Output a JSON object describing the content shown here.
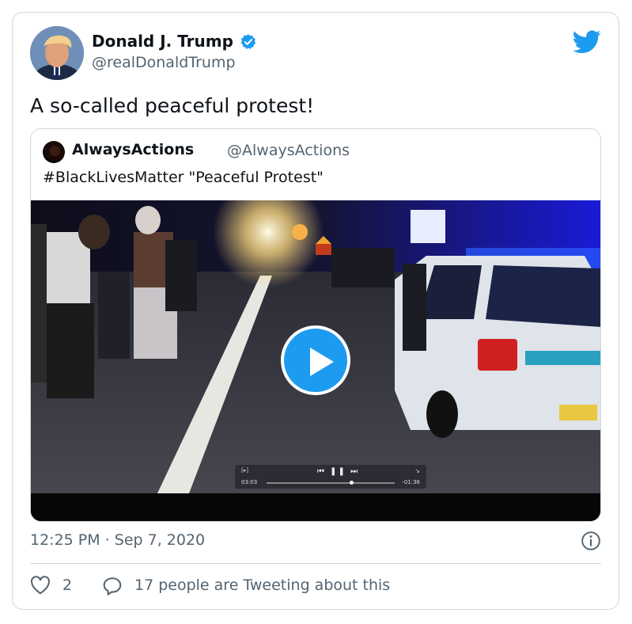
{
  "tweet": {
    "author_name": "Donald J. Trump",
    "author_handle": "@realDonaldTrump",
    "verified": true,
    "text": "A so-called peaceful protest!",
    "timestamp": "12:25 PM · Sep 7, 2020"
  },
  "quoted_tweet": {
    "author_name": "AlwaysActions",
    "author_handle": "@AlwaysActions",
    "text": "#BlackLivesMatter \"Peaceful Protest\"",
    "video": {
      "elapsed": "03:03",
      "remaining": "-01:36",
      "progress_fraction": 0.66
    }
  },
  "engagement": {
    "like_count": "2",
    "reply_text": "17 people are Tweeting about this"
  },
  "colors": {
    "accent": "#1d9bf0",
    "text_primary": "#0f1419",
    "text_secondary": "#536471",
    "border": "#cfd9de",
    "like_icon": "#e0245e"
  },
  "icons": [
    "verified-badge-icon",
    "twitter-bird-icon",
    "play-icon",
    "info-icon",
    "heart-icon",
    "reply-bubble-icon"
  ]
}
